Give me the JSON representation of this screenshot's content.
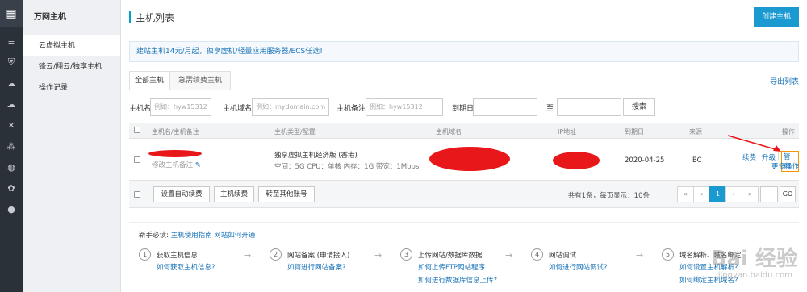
{
  "sidebar": {
    "title": "万网主机",
    "items": [
      {
        "label": "云虚拟主机",
        "active": true
      },
      {
        "label": "锋云/翔云/独享主机",
        "active": false
      },
      {
        "label": "操作记录",
        "active": false
      }
    ]
  },
  "header": {
    "title": "主机列表",
    "create_button": "创建主机"
  },
  "notice": "建站主机14元/月起，独享虚机/轻量应用服务器/ECS任选!",
  "tabs": [
    "全部主机",
    "急需续费主机"
  ],
  "export_label": "导出列表",
  "filters": {
    "host_name_label": "主机名:",
    "host_name_placeholder": "例如：hyw15312",
    "domain_label": "主机域名:",
    "domain_placeholder": "例如：mydomain.com",
    "remark_label": "主机备注:",
    "remark_placeholder": "例如：hyw15312",
    "expire_label": "到期日:",
    "to_label": "至",
    "search_button": "搜索"
  },
  "table": {
    "headers": [
      "主机名/主机备注",
      "主机类型/配置",
      "主机域名",
      "IP地址",
      "到期日",
      "来源",
      "操作"
    ],
    "rows": [
      {
        "remark_link": "修改主机备注",
        "type": "独享虚拟主机经济版 (香港)",
        "config": "空间：5G CPU：单核 内存：1G 带宽：1Mbps",
        "expire": "2020-04-25",
        "source": "BC",
        "actions": {
          "renew": "续费",
          "upgrade": "升级",
          "manage": "管理",
          "more": "更多操作"
        }
      }
    ]
  },
  "footer": {
    "auto_renew": "设置自动续费",
    "renew": "主机续费",
    "transfer": "转至其他账号",
    "pager_info": "共有1条，每页显示：10条",
    "pages": [
      "«",
      "‹",
      "1",
      "›",
      "»"
    ],
    "go": "GO"
  },
  "guide": {
    "title": "新手必读:",
    "link1": "主机使用指南",
    "link2": "网站如何开通",
    "steps": [
      {
        "num": "1",
        "title": "获取主机信息",
        "links": [
          "如何获取主机信息?"
        ]
      },
      {
        "num": "2",
        "title": "网站备案 (申请接入)",
        "links": [
          "如何进行网站备案?"
        ]
      },
      {
        "num": "3",
        "title": "上传网站/数据库数据",
        "links": [
          "如何上传FTP网站程序",
          "如何进行数据库信息上传?"
        ]
      },
      {
        "num": "4",
        "title": "网站调试",
        "links": [
          "如何进行网站调试?"
        ]
      },
      {
        "num": "5",
        "title": "域名解析、域名绑定",
        "links": [
          "如何设置主机解析?",
          "如何绑定主机域名?"
        ]
      }
    ],
    "arrow": "→"
  },
  "watermark": {
    "text": "Bai 经验",
    "sub": "jingyan.baidu.com"
  },
  "icons": [
    "apps-grid-icon",
    "list-icon",
    "shield-icon",
    "cloud-icon",
    "cloud-upload-icon",
    "cross-icon",
    "network-icon",
    "globe-icon",
    "puzzle-icon",
    "circle-icon"
  ],
  "colors": {
    "accent": "#1b9ad2",
    "sidebar_dark": "#2b3138",
    "link": "#1772b7",
    "highlight": "#f39800",
    "redaction": "#e8171a"
  }
}
